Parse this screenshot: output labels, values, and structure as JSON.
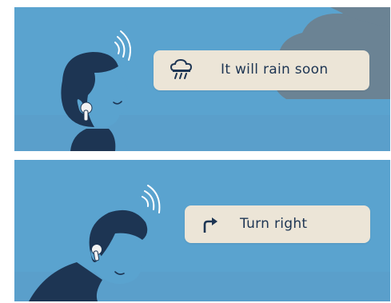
{
  "panels": [
    {
      "id": "rain",
      "notification_text": "It will rain soon",
      "icon": "rain-cloud-icon"
    },
    {
      "id": "turn",
      "notification_text": "Turn right",
      "icon": "turn-right-arrow-icon"
    }
  ],
  "colors": {
    "sky": "#5aa3cf",
    "sky_light": "#6fb0d8",
    "cloud_grey": "#6b8394",
    "pill_bg": "#ece5d7",
    "navy": "#1d3553",
    "skin": "#5aa3cf",
    "earbud": "#f2f2f2"
  }
}
